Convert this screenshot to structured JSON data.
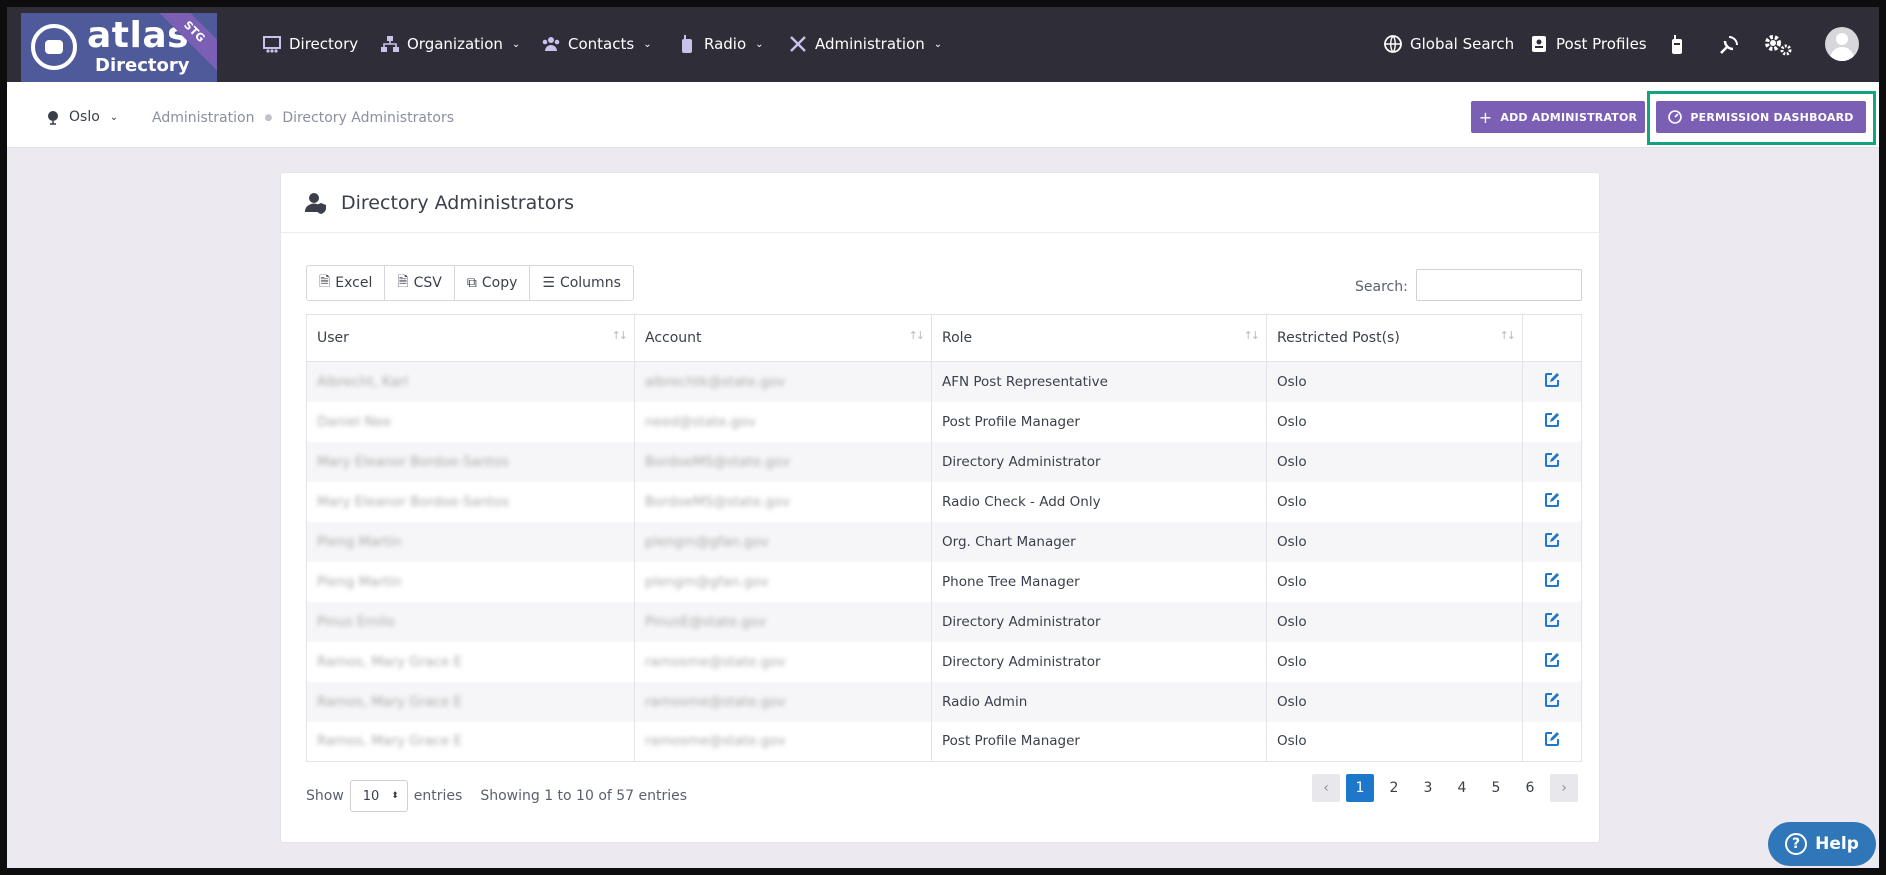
{
  "app": {
    "logo_word1": "atlas",
    "logo_word2": "Directory",
    "env_badge": "STG"
  },
  "nav": {
    "items": [
      {
        "label": "Directory",
        "has_caret": false
      },
      {
        "label": "Organization",
        "has_caret": true
      },
      {
        "label": "Contacts",
        "has_caret": true
      },
      {
        "label": "Radio",
        "has_caret": true
      },
      {
        "label": "Administration",
        "has_caret": true
      }
    ],
    "global_search": "Global Search",
    "post_profiles": "Post Profiles"
  },
  "subheader": {
    "post": "Oslo",
    "breadcrumb": [
      "Administration",
      "Directory Administrators"
    ],
    "add_button": "ADD ADMINISTRATOR",
    "permission_button": "PERMISSION DASHBOARD"
  },
  "card": {
    "title": "Directory Administrators",
    "tools": [
      "Excel",
      "CSV",
      "Copy",
      "Columns"
    ],
    "search_label": "Search:",
    "columns": [
      "User",
      "Account",
      "Role",
      "Restricted Post(s)"
    ],
    "rows": [
      {
        "user": "Albrecht, Karl",
        "account": "albrechtk@state.gov",
        "role": "AFN Post Representative",
        "post": "Oslo"
      },
      {
        "user": "Daniel Nee",
        "account": "need@state.gov",
        "role": "Post Profile Manager",
        "post": "Oslo"
      },
      {
        "user": "Mary Eleanor Bordoe-Santos",
        "account": "BordoeMS@state.gov",
        "role": "Directory Administrator",
        "post": "Oslo"
      },
      {
        "user": "Mary Eleanor Bordoe-Santos",
        "account": "BordoeMS@state.gov",
        "role": "Radio Check - Add Only",
        "post": "Oslo"
      },
      {
        "user": "Pleng Martin",
        "account": "plengm@gfan.gov",
        "role": "Org. Chart Manager",
        "post": "Oslo"
      },
      {
        "user": "Pleng Martin",
        "account": "plengm@gfan.gov",
        "role": "Phone Tree Manager",
        "post": "Oslo"
      },
      {
        "user": "Pinus Emilo",
        "account": "PinusE@state.gov",
        "role": "Directory Administrator",
        "post": "Oslo"
      },
      {
        "user": "Ramos, Mary Grace E",
        "account": "ramosme@state.gov",
        "role": "Directory Administrator",
        "post": "Oslo"
      },
      {
        "user": "Ramos, Mary Grace E",
        "account": "ramosme@state.gov",
        "role": "Radio Admin",
        "post": "Oslo"
      },
      {
        "user": "Ramos, Mary Grace E",
        "account": "ramosme@state.gov",
        "role": "Post Profile Manager",
        "post": "Oslo"
      }
    ],
    "show_label": "Show",
    "page_length": "10",
    "entries_label": "entries",
    "info": "Showing 1 to 10 of 57 entries",
    "pages": [
      "1",
      "2",
      "3",
      "4",
      "5",
      "6"
    ],
    "current_page": "1"
  },
  "help": "Help",
  "colors": {
    "nav_bg": "#2e2d38",
    "accent": "#7a5fb5",
    "link_blue": "#1e78c9",
    "highlight": "#13a37f"
  }
}
